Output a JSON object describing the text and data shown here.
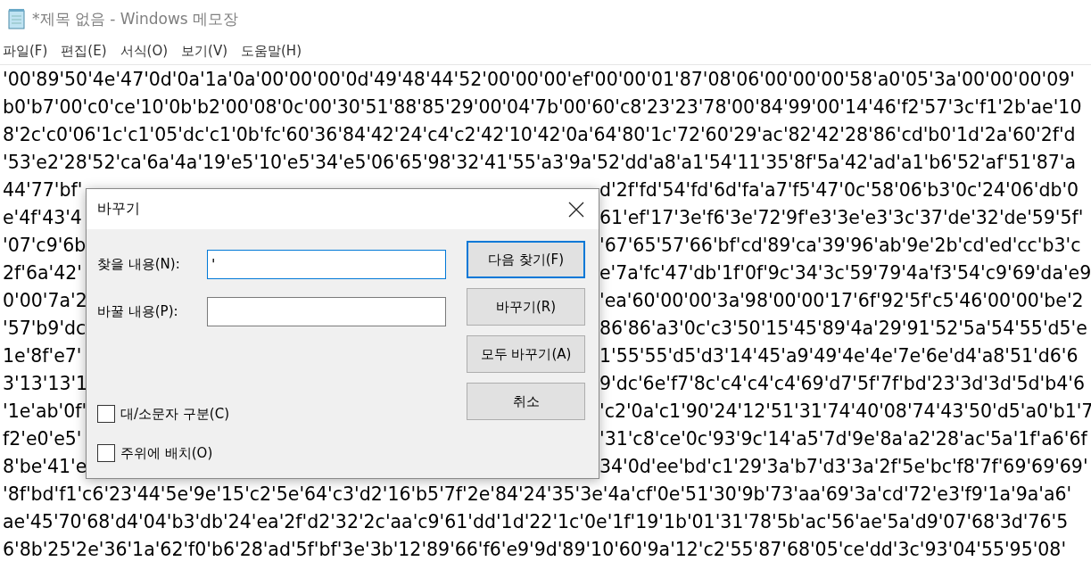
{
  "window": {
    "title": "*제목 없음 - Windows 메모장"
  },
  "menu": [
    {
      "label": "파일(F)"
    },
    {
      "label": "편집(E)"
    },
    {
      "label": "서식(O)"
    },
    {
      "label": "보기(V)"
    },
    {
      "label": "도움말(H)"
    }
  ],
  "document": {
    "lines": [
      {
        "kind": "full",
        "text": "'00'89'50'4e'47'0d'0a'1a'0a'00'00'00'0d'49'48'44'52'00'00'00'ef'00'00'01'87'08'06'00'00'00'58'a0'05'3a'00'00'00'09'"
      },
      {
        "kind": "full",
        "text": "b0'b7'00'c0'ce'10'0b'b2'00'08'0c'00'30'51'88'85'29'00'04'7b'00'60'c8'23'23'78'00'84'99'00'14'46'f2'57'3c'f1'2b'ae'10"
      },
      {
        "kind": "full",
        "text": "8'2c'c0'06'1c'c1'05'dc'c1'0b'fc'60'36'84'42'24'c4'c2'42'10'42'0a'64'80'1c'72'60'29'ac'82'42'28'86'cd'b0'1d'2a'60'2f'd"
      },
      {
        "kind": "full",
        "text": "'53'e2'28'52'ca'6a'4a'19'e5'10'e5'34'e5'06'65'98'32'41'55'a3'9a'52'dd'a8'a1'54'11'35'8f'5a'42'ad'a1'b6'52'af'51'87'a"
      },
      {
        "kind": "split",
        "left": "44'77'bf'",
        "right": "d'2f'fd'54'fd'6d'fa'a7'f5'47'0c'58'06'b3'0c'24'06'db'0"
      },
      {
        "kind": "split",
        "left": "e'4f'43'4",
        "right": "61'ef'17'3e'f6'3e'72'9f'e3'3e'e3'3c'37'de'32'de'59'5f'"
      },
      {
        "kind": "split",
        "left": "'07'c9'6b",
        "right": "'67'65'57'66'bf'cd'89'ca'39'96'ab'9e'2b'cd'ed'cc'b3'c"
      },
      {
        "kind": "split",
        "left": "2f'6a'42'",
        "right": "e'7a'fc'47'db'1f'0f'9c'34'3c'59'79'4a'f3'54'c9'69'da'e9"
      },
      {
        "kind": "split",
        "left": "0'00'7a'2",
        "right": "'ea'60'00'00'3a'98'00'00'17'6f'92'5f'c5'46'00'00'be'2"
      },
      {
        "kind": "split",
        "left": "'57'b9'dc",
        "right": "86'86'a3'0c'c3'50'15'45'89'4a'29'91'52'5a'54'55'd5'e"
      },
      {
        "kind": "split",
        "left": "1e'8f'e7'",
        "right": "1'55'55'd5'd3'14'45'a9'49'4e'4e'7e'6e'd4'a8'51'd6'6"
      },
      {
        "kind": "split",
        "left": "3'13'13'1",
        "right": "9'dc'6e'f7'8c'c4'c4'c4'69'd7'5f'7f'bd'23'3d'3d'5d'b4'6"
      },
      {
        "kind": "split",
        "left": "'1e'ab'0f'",
        "right": "'c2'0a'c1'90'24'12'51'31'74'40'08'74'43'50'd5'a0'b1'7"
      },
      {
        "kind": "split",
        "left": "f2'e0'e5'",
        "right": "'31'c8'ce'0c'93'9c'14'a5'7d'9e'8a'a2'28'ac'5a'1f'a6'6f"
      },
      {
        "kind": "split",
        "left": "8'be'41'e",
        "right": "34'0d'ee'bd'c1'29'3a'b7'd3'3a'2f'5e'bc'f8'7f'69'69'69'"
      },
      {
        "kind": "full",
        "text": "'8f'bd'f1'c6'23'44'5e'9e'15'c2'5e'64'c3'd2'16'b5'7f'2e'84'24'35'3e'4a'cf'0e'51'30'9b'73'aa'69'3a'cd'72'e3'f9'1a'9a'a6'"
      },
      {
        "kind": "full",
        "text": "ae'45'70'68'd4'04'b3'db'24'ea'2f'd2'32'2c'aa'c9'61'dd'1d'22'1c'0e'1f'19'1b'01'31'78'5b'ac'56'ae'5a'd9'07'68'3d'76'5"
      },
      {
        "kind": "full",
        "text": "6'8b'25'2e'36'1a'62'f0'b6'28'ad'5f'bf'3e'3b'12'89'66'f6'e9'9d'89'10'60'9a'12'c2'55'87'68'05'ce'dd'3c'93'04'55'95'08'"
      }
    ]
  },
  "dialog": {
    "title": "바꾸기",
    "fields": [
      {
        "label": "찾을 내용(N):",
        "value": "'",
        "focused": true
      },
      {
        "label": "바꿀 내용(P):",
        "focused": false
      }
    ],
    "buttons": [
      {
        "label": "다음 찾기(F)",
        "default": true
      },
      {
        "label": "바꾸기(R)",
        "default": false
      },
      {
        "label": "모두 바꾸기(A)",
        "default": false
      },
      {
        "label": "취소",
        "default": false
      }
    ],
    "options": [
      {
        "label": "대/소문자 구분(C)",
        "checked": false
      },
      {
        "label": "주위에 배치(O)",
        "checked": false
      }
    ]
  }
}
